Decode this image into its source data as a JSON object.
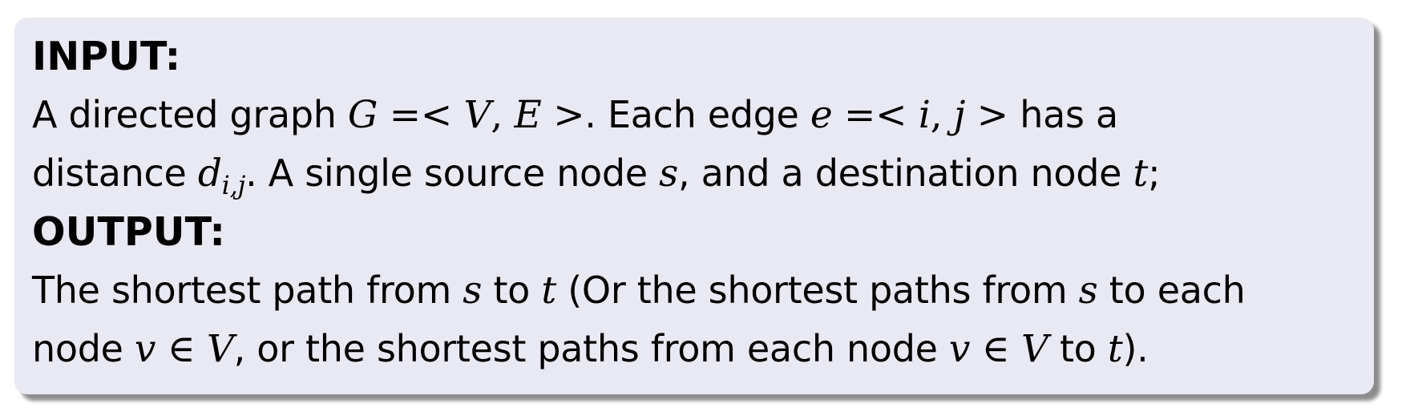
{
  "input": {
    "heading": "INPUT:",
    "line1": {
      "t1": "A directed graph ",
      "G": "G",
      "eq1": " =< ",
      "V": "V",
      "comma1": ", ",
      "E": "E",
      "gt1": " >",
      "t2": ". Each edge ",
      "e": "e",
      "eq2": " =< ",
      "i": "i",
      "comma2": ", ",
      "j": "j",
      "gt2": " >",
      "t3": " has a"
    },
    "line2": {
      "t1": "distance ",
      "d": "d",
      "sub": "i,j",
      "t2": ". A single source node ",
      "s": "s",
      "t3": ", and a destination node ",
      "t": "t",
      "t4": ";"
    }
  },
  "output": {
    "heading": "OUTPUT:",
    "line1": {
      "t1": "The shortest path from ",
      "s1": "s",
      "t2": " to ",
      "t1v": "t",
      "t3": " (Or the shortest paths from ",
      "s2": "s",
      "t4": " to each"
    },
    "line2": {
      "t1": "node ",
      "v1": "v",
      "in1": " ∈ ",
      "V1": "V",
      "t2": ", or the shortest paths from each node ",
      "v2": "v",
      "in2": " ∈ ",
      "V2": "V",
      "t3": " to ",
      "tv": "t",
      "t4": ")."
    }
  }
}
